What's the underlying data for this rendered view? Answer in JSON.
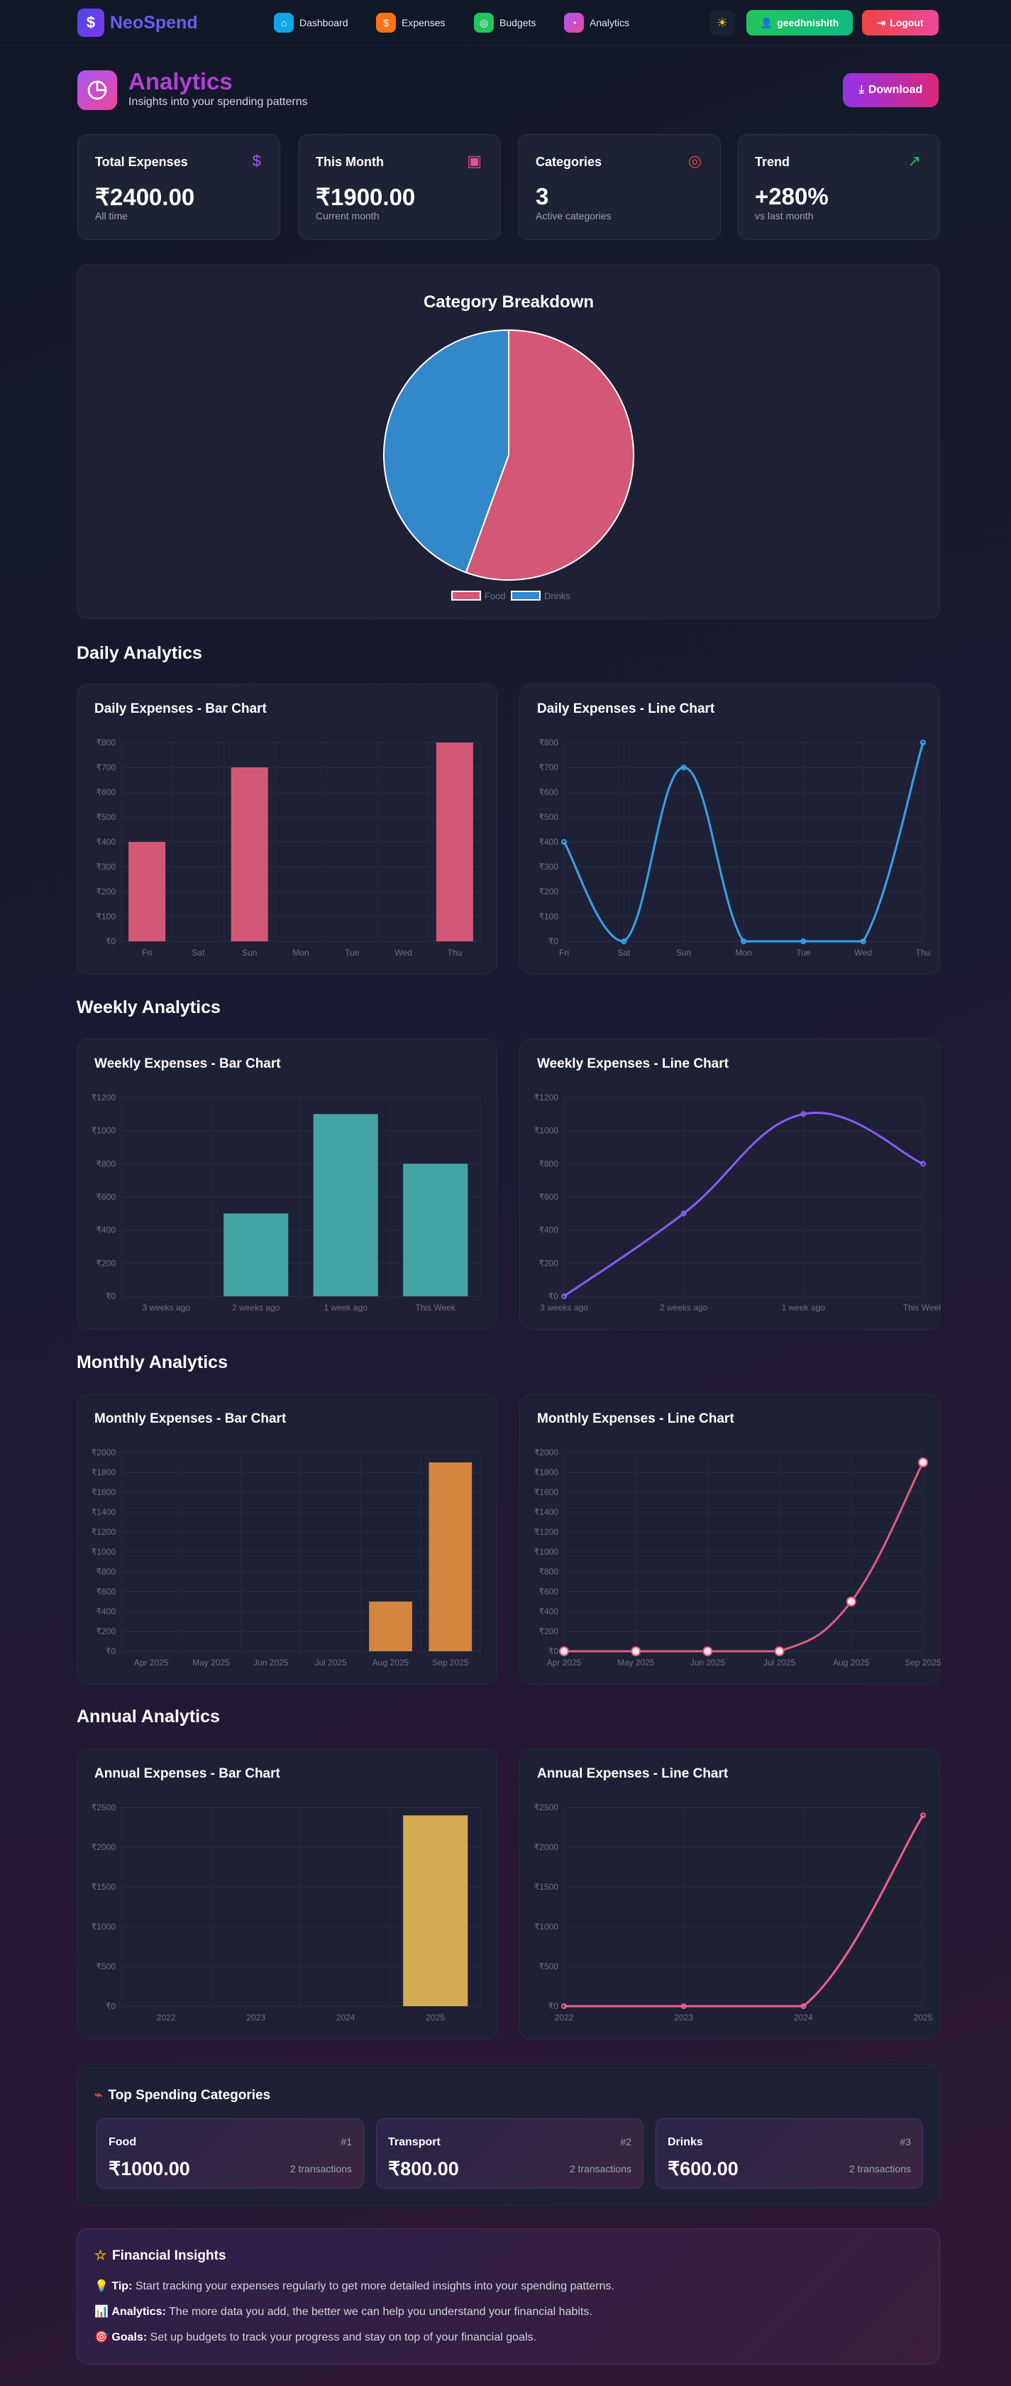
{
  "nav": {
    "brand": "NeoSpend",
    "items": [
      {
        "label": "Dashboard",
        "color": "#0ea5e9",
        "icon": "⌂"
      },
      {
        "label": "Expenses",
        "color": "#f97316",
        "icon": "$"
      },
      {
        "label": "Budgets",
        "color": "#22c55e",
        "icon": "◎"
      },
      {
        "label": "Analytics",
        "color": "#c026d3",
        "icon": "◔"
      }
    ],
    "user": "geedhnishith",
    "logout": "Logout"
  },
  "header": {
    "title": "Analytics",
    "subtitle": "Insights into your spending patterns",
    "download": "Download"
  },
  "stats": [
    {
      "title": "Total Expenses",
      "value": "₹2400.00",
      "sub": "All time",
      "icon": "$",
      "color": "#a855f7"
    },
    {
      "title": "This Month",
      "value": "₹1900.00",
      "sub": "Current month",
      "icon": "▣",
      "color": "#ec4899"
    },
    {
      "title": "Categories",
      "value": "3",
      "sub": "Active categories",
      "icon": "◎",
      "color": "#ef4444"
    },
    {
      "title": "Trend",
      "value": "+280%",
      "sub": "vs last month",
      "icon": "↗",
      "color": "#22c55e"
    }
  ],
  "sections": {
    "daily": "Daily Analytics",
    "weekly": "Weekly Analytics",
    "monthly": "Monthly Analytics",
    "annual": "Annual Analytics"
  },
  "chart_data": [
    {
      "id": "pie",
      "type": "pie",
      "title": "Category Breakdown",
      "labels": [
        "Food",
        "Drinks"
      ],
      "values": [
        1000,
        800
      ],
      "colors": [
        "#d35876",
        "#3388c9"
      ],
      "legend": "bottom"
    },
    {
      "id": "daily-bar",
      "type": "bar",
      "title": "Daily Expenses - Bar Chart",
      "categories": [
        "Fri",
        "Sat",
        "Sun",
        "Mon",
        "Tue",
        "Wed",
        "Thu"
      ],
      "values": [
        400,
        0,
        700,
        0,
        0,
        0,
        800
      ],
      "ylim": [
        0,
        800
      ],
      "step": 100,
      "color": "#d35876",
      "yticks": [
        "₹0",
        "₹100",
        "₹200",
        "₹300",
        "₹400",
        "₹500",
        "₹600",
        "₹700",
        "₹800"
      ]
    },
    {
      "id": "daily-line",
      "type": "line",
      "title": "Daily Expenses - Line Chart",
      "categories": [
        "Fri",
        "Sat",
        "Sun",
        "Mon",
        "Tue",
        "Wed",
        "Thu"
      ],
      "values": [
        400,
        0,
        700,
        0,
        0,
        0,
        800
      ],
      "ylim": [
        0,
        800
      ],
      "step": 100,
      "color": "#36a2eb",
      "yticks": [
        "₹0",
        "₹100",
        "₹200",
        "₹300",
        "₹400",
        "₹500",
        "₹600",
        "₹700",
        "₹800"
      ]
    },
    {
      "id": "weekly-bar",
      "type": "bar",
      "title": "Weekly Expenses - Bar Chart",
      "categories": [
        "3 weeks ago",
        "2 weeks ago",
        "1 week ago",
        "This Week"
      ],
      "values": [
        0,
        500,
        1100,
        800
      ],
      "ylim": [
        0,
        1200
      ],
      "step": 200,
      "color": "#45a5a5",
      "yticks": [
        "₹0",
        "₹200",
        "₹400",
        "₹600",
        "₹800",
        "₹1000",
        "₹1200"
      ]
    },
    {
      "id": "weekly-line",
      "type": "line",
      "title": "Weekly Expenses - Line Chart",
      "categories": [
        "3 weeks ago",
        "2 weeks ago",
        "1 week ago",
        "This Week"
      ],
      "values": [
        0,
        500,
        1100,
        800
      ],
      "ylim": [
        0,
        1200
      ],
      "step": 200,
      "color": "#8b5cf6",
      "yticks": [
        "₹0",
        "₹200",
        "₹400",
        "₹600",
        "₹800",
        "₹1000",
        "₹1200"
      ]
    },
    {
      "id": "monthly-bar",
      "type": "bar",
      "title": "Monthly Expenses - Bar Chart",
      "categories": [
        "Apr 2025",
        "May 2025",
        "Jun 2025",
        "Jul 2025",
        "Aug 2025",
        "Sep 2025"
      ],
      "values": [
        0,
        0,
        0,
        0,
        500,
        1900
      ],
      "ylim": [
        0,
        2000
      ],
      "step": 200,
      "color": "#d4863e",
      "yticks": [
        "₹0",
        "₹200",
        "₹400",
        "₹600",
        "₹800",
        "₹1000",
        "₹1200",
        "₹1400",
        "₹1600",
        "₹1800",
        "₹2000"
      ]
    },
    {
      "id": "monthly-line",
      "type": "line",
      "title": "Monthly Expenses - Line Chart",
      "categories": [
        "Apr 2025",
        "May 2025",
        "Jun 2025",
        "Jul 2025",
        "Aug 2025",
        "Sep 2025"
      ],
      "values": [
        0,
        0,
        0,
        0,
        500,
        1900
      ],
      "ylim": [
        0,
        2000
      ],
      "step": 200,
      "color": "#e05a80",
      "bigPoints": true,
      "yticks": [
        "₹0",
        "₹200",
        "₹400",
        "₹600",
        "₹800",
        "₹1000",
        "₹1200",
        "₹1400",
        "₹1600",
        "₹1800",
        "₹2000"
      ]
    },
    {
      "id": "annual-bar",
      "type": "bar",
      "title": "Annual Expenses - Bar Chart",
      "categories": [
        "2022",
        "2023",
        "2024",
        "2025"
      ],
      "values": [
        0,
        0,
        0,
        2400
      ],
      "ylim": [
        0,
        2500
      ],
      "step": 500,
      "color": "#d4ad52",
      "yticks": [
        "₹0",
        "₹500",
        "₹1000",
        "₹1500",
        "₹2000",
        "₹2500"
      ]
    },
    {
      "id": "annual-line",
      "type": "line",
      "title": "Annual Expenses - Line Chart",
      "categories": [
        "2022",
        "2023",
        "2024",
        "2025"
      ],
      "values": [
        0,
        0,
        0,
        2400
      ],
      "ylim": [
        0,
        2500
      ],
      "step": 500,
      "color": "#f0608a",
      "yticks": [
        "₹0",
        "₹500",
        "₹1000",
        "₹1500",
        "₹2000",
        "₹2500"
      ]
    }
  ],
  "top": {
    "title": "Top Spending Categories",
    "items": [
      {
        "name": "Food",
        "rank": "#1",
        "amount": "₹1000.00",
        "count": "2 transactions"
      },
      {
        "name": "Transport",
        "rank": "#2",
        "amount": "₹800.00",
        "count": "2 transactions"
      },
      {
        "name": "Drinks",
        "rank": "#3",
        "amount": "₹600.00",
        "count": "2 transactions"
      }
    ]
  },
  "insights": {
    "title": "Financial Insights",
    "items": [
      {
        "emoji": "💡",
        "label": "Tip:",
        "text": " Start tracking your expenses regularly to get more detailed insights into your spending patterns."
      },
      {
        "emoji": "📊",
        "label": "Analytics:",
        "text": " The more data you add, the better we can help you understand your financial habits."
      },
      {
        "emoji": "🎯",
        "label": "Goals:",
        "text": " Set up budgets to track your progress and stay on top of your financial goals."
      }
    ]
  }
}
